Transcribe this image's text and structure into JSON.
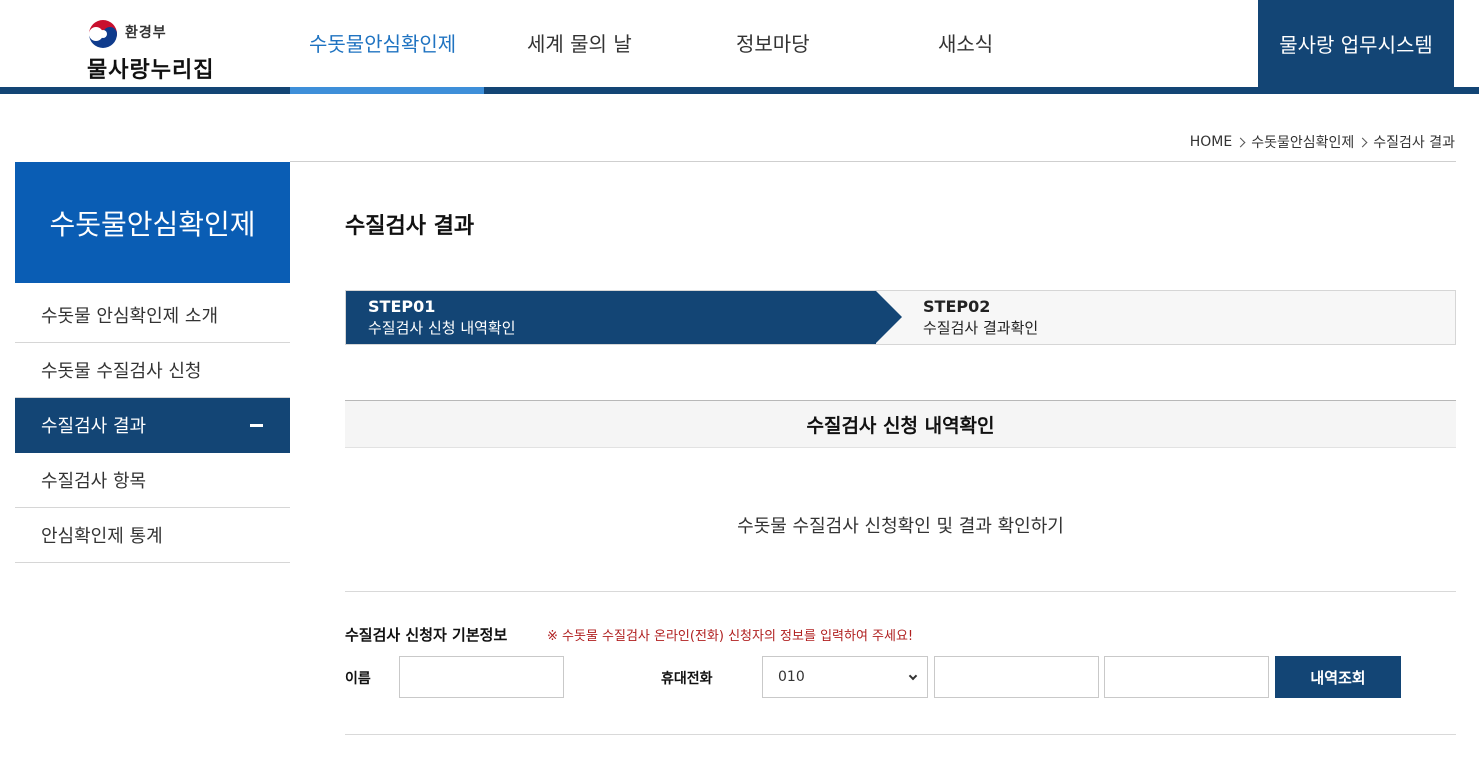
{
  "header": {
    "logo_ministry": "환경부",
    "logo_name": "물사랑누리집",
    "nav": [
      {
        "label": "수돗물안심확인제",
        "active": true
      },
      {
        "label": "세계 물의 날",
        "active": false
      },
      {
        "label": "정보마당",
        "active": false
      },
      {
        "label": "새소식",
        "active": false
      }
    ],
    "work_system": "물사랑 업무시스템"
  },
  "breadcrumb": [
    "HOME",
    "수돗물안심확인제",
    "수질검사 결과"
  ],
  "sidebar": {
    "title": "수돗물안심확인제",
    "items": [
      {
        "label": "수돗물 안심확인제 소개",
        "active": false
      },
      {
        "label": "수돗물 수질검사 신청",
        "active": false
      },
      {
        "label": "수질검사 결과",
        "active": true
      },
      {
        "label": "수질검사 항목",
        "active": false
      },
      {
        "label": "안심확인제 통계",
        "active": false
      }
    ]
  },
  "content": {
    "page_title": "수질검사 결과",
    "steps": [
      {
        "label": "STEP01",
        "desc": "수질검사 신청 내역확인",
        "active": true
      },
      {
        "label": "STEP02",
        "desc": "수질검사 결과확인",
        "active": false
      }
    ],
    "section_title": "수질검사 신청 내역확인",
    "intro": "수돗물 수질검사 신청확인 및 결과 확인하기",
    "form": {
      "title": "수질검사 신청자 기본정보",
      "notice": "※ 수돗물 수질검사 온라인(전화) 신청자의 정보를 입력하여 주세요!",
      "name_label": "이름",
      "name_value": "",
      "phone_label": "휴대전화",
      "phone_prefix": "010",
      "phone_mid": "",
      "phone_last": "",
      "submit": "내역조회"
    }
  },
  "colors": {
    "navy": "#134575",
    "blue": "#0a5db4",
    "accent": "#3e8fd9",
    "notice_red": "#b02020"
  }
}
